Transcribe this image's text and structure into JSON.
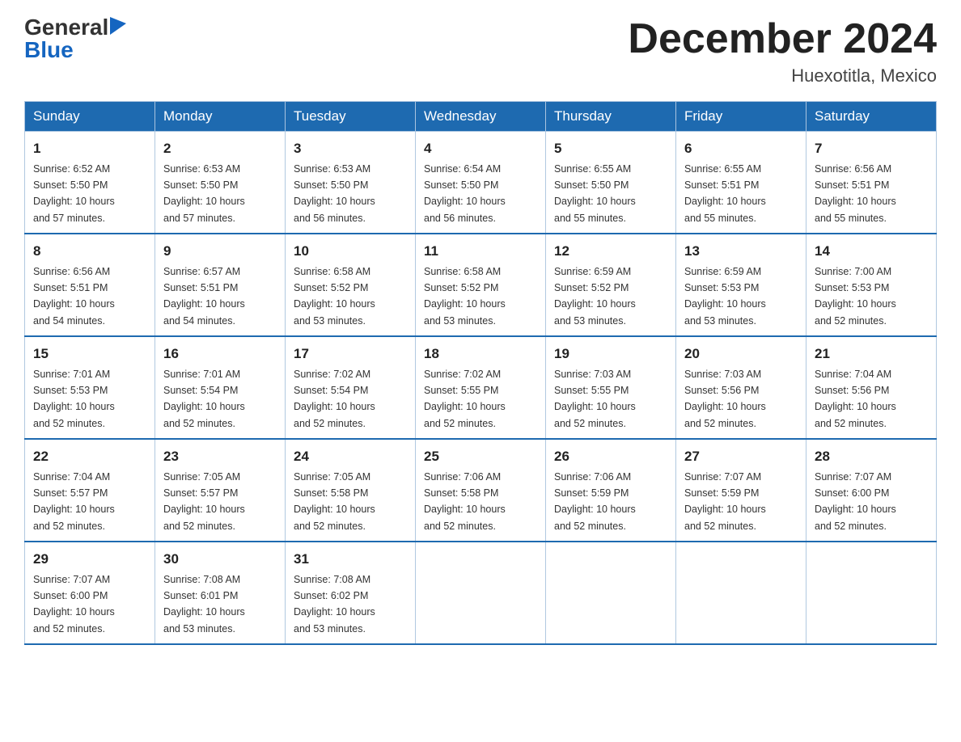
{
  "header": {
    "logo": {
      "general": "General",
      "blue": "Blue",
      "arrow": "▶"
    },
    "title": "December 2024",
    "subtitle": "Huexotitla, Mexico"
  },
  "weekdays": [
    "Sunday",
    "Monday",
    "Tuesday",
    "Wednesday",
    "Thursday",
    "Friday",
    "Saturday"
  ],
  "weeks": [
    [
      {
        "day": "1",
        "sunrise": "6:52 AM",
        "sunset": "5:50 PM",
        "daylight": "10 hours and 57 minutes."
      },
      {
        "day": "2",
        "sunrise": "6:53 AM",
        "sunset": "5:50 PM",
        "daylight": "10 hours and 57 minutes."
      },
      {
        "day": "3",
        "sunrise": "6:53 AM",
        "sunset": "5:50 PM",
        "daylight": "10 hours and 56 minutes."
      },
      {
        "day": "4",
        "sunrise": "6:54 AM",
        "sunset": "5:50 PM",
        "daylight": "10 hours and 56 minutes."
      },
      {
        "day": "5",
        "sunrise": "6:55 AM",
        "sunset": "5:50 PM",
        "daylight": "10 hours and 55 minutes."
      },
      {
        "day": "6",
        "sunrise": "6:55 AM",
        "sunset": "5:51 PM",
        "daylight": "10 hours and 55 minutes."
      },
      {
        "day": "7",
        "sunrise": "6:56 AM",
        "sunset": "5:51 PM",
        "daylight": "10 hours and 55 minutes."
      }
    ],
    [
      {
        "day": "8",
        "sunrise": "6:56 AM",
        "sunset": "5:51 PM",
        "daylight": "10 hours and 54 minutes."
      },
      {
        "day": "9",
        "sunrise": "6:57 AM",
        "sunset": "5:51 PM",
        "daylight": "10 hours and 54 minutes."
      },
      {
        "day": "10",
        "sunrise": "6:58 AM",
        "sunset": "5:52 PM",
        "daylight": "10 hours and 53 minutes."
      },
      {
        "day": "11",
        "sunrise": "6:58 AM",
        "sunset": "5:52 PM",
        "daylight": "10 hours and 53 minutes."
      },
      {
        "day": "12",
        "sunrise": "6:59 AM",
        "sunset": "5:52 PM",
        "daylight": "10 hours and 53 minutes."
      },
      {
        "day": "13",
        "sunrise": "6:59 AM",
        "sunset": "5:53 PM",
        "daylight": "10 hours and 53 minutes."
      },
      {
        "day": "14",
        "sunrise": "7:00 AM",
        "sunset": "5:53 PM",
        "daylight": "10 hours and 52 minutes."
      }
    ],
    [
      {
        "day": "15",
        "sunrise": "7:01 AM",
        "sunset": "5:53 PM",
        "daylight": "10 hours and 52 minutes."
      },
      {
        "day": "16",
        "sunrise": "7:01 AM",
        "sunset": "5:54 PM",
        "daylight": "10 hours and 52 minutes."
      },
      {
        "day": "17",
        "sunrise": "7:02 AM",
        "sunset": "5:54 PM",
        "daylight": "10 hours and 52 minutes."
      },
      {
        "day": "18",
        "sunrise": "7:02 AM",
        "sunset": "5:55 PM",
        "daylight": "10 hours and 52 minutes."
      },
      {
        "day": "19",
        "sunrise": "7:03 AM",
        "sunset": "5:55 PM",
        "daylight": "10 hours and 52 minutes."
      },
      {
        "day": "20",
        "sunrise": "7:03 AM",
        "sunset": "5:56 PM",
        "daylight": "10 hours and 52 minutes."
      },
      {
        "day": "21",
        "sunrise": "7:04 AM",
        "sunset": "5:56 PM",
        "daylight": "10 hours and 52 minutes."
      }
    ],
    [
      {
        "day": "22",
        "sunrise": "7:04 AM",
        "sunset": "5:57 PM",
        "daylight": "10 hours and 52 minutes."
      },
      {
        "day": "23",
        "sunrise": "7:05 AM",
        "sunset": "5:57 PM",
        "daylight": "10 hours and 52 minutes."
      },
      {
        "day": "24",
        "sunrise": "7:05 AM",
        "sunset": "5:58 PM",
        "daylight": "10 hours and 52 minutes."
      },
      {
        "day": "25",
        "sunrise": "7:06 AM",
        "sunset": "5:58 PM",
        "daylight": "10 hours and 52 minutes."
      },
      {
        "day": "26",
        "sunrise": "7:06 AM",
        "sunset": "5:59 PM",
        "daylight": "10 hours and 52 minutes."
      },
      {
        "day": "27",
        "sunrise": "7:07 AM",
        "sunset": "5:59 PM",
        "daylight": "10 hours and 52 minutes."
      },
      {
        "day": "28",
        "sunrise": "7:07 AM",
        "sunset": "6:00 PM",
        "daylight": "10 hours and 52 minutes."
      }
    ],
    [
      {
        "day": "29",
        "sunrise": "7:07 AM",
        "sunset": "6:00 PM",
        "daylight": "10 hours and 52 minutes."
      },
      {
        "day": "30",
        "sunrise": "7:08 AM",
        "sunset": "6:01 PM",
        "daylight": "10 hours and 53 minutes."
      },
      {
        "day": "31",
        "sunrise": "7:08 AM",
        "sunset": "6:02 PM",
        "daylight": "10 hours and 53 minutes."
      },
      null,
      null,
      null,
      null
    ]
  ],
  "labels": {
    "sunrise": "Sunrise:",
    "sunset": "Sunset:",
    "daylight": "Daylight:"
  }
}
